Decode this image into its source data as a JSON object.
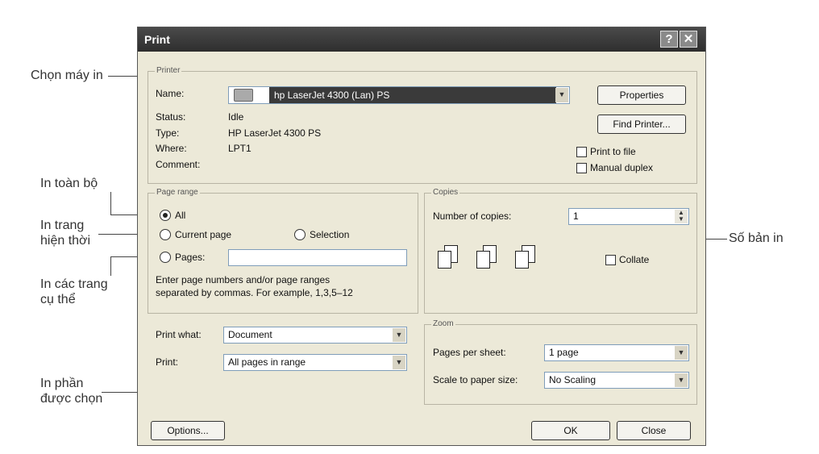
{
  "annotations": {
    "choose_printer": "Chọn máy in",
    "print_all": "In toàn bộ",
    "print_current_l1": "In trang",
    "print_current_l2": "hiện thời",
    "print_pages_l1": "In các trang",
    "print_pages_l2": "cụ thể",
    "print_selection_l1": "In phần",
    "print_selection_l2": "được chọn",
    "copies_count": "Số bản in"
  },
  "dialog": {
    "title": "Print",
    "help_button": "?",
    "close_button": "✕",
    "printer": {
      "group_title": "Printer",
      "name_label": "Name:",
      "name_value": "hp LaserJet 4300 (Lan) PS",
      "status_label": "Status:",
      "status_value": "Idle",
      "type_label": "Type:",
      "type_value": "HP LaserJet 4300 PS",
      "where_label": "Where:",
      "where_value": "LPT1",
      "comment_label": "Comment:",
      "properties_button": "Properties",
      "find_printer_button": "Find Printer...",
      "print_to_file": "Print to file",
      "manual_duplex": "Manual duplex"
    },
    "page_range": {
      "group_title": "Page range",
      "all": "All",
      "current_page": "Current page",
      "selection": "Selection",
      "pages": "Pages:",
      "pages_value": "",
      "help_text_l1": "Enter page numbers and/or page ranges",
      "help_text_l2": "separated by commas.  For example, 1,3,5–12"
    },
    "copies": {
      "group_title": "Copies",
      "number_label": "Number of copies:",
      "number_value": "1",
      "collate": "Collate"
    },
    "print_what": {
      "label": "Print what:",
      "value": "Document"
    },
    "print": {
      "label": "Print:",
      "value": "All pages in range"
    },
    "zoom": {
      "group_title": "Zoom",
      "pages_per_sheet_label": "Pages per sheet:",
      "pages_per_sheet_value": "1 page",
      "scale_label": "Scale to paper size:",
      "scale_value": "No Scaling"
    },
    "options_button": "Options...",
    "ok_button": "OK",
    "close_footer_button": "Close"
  }
}
